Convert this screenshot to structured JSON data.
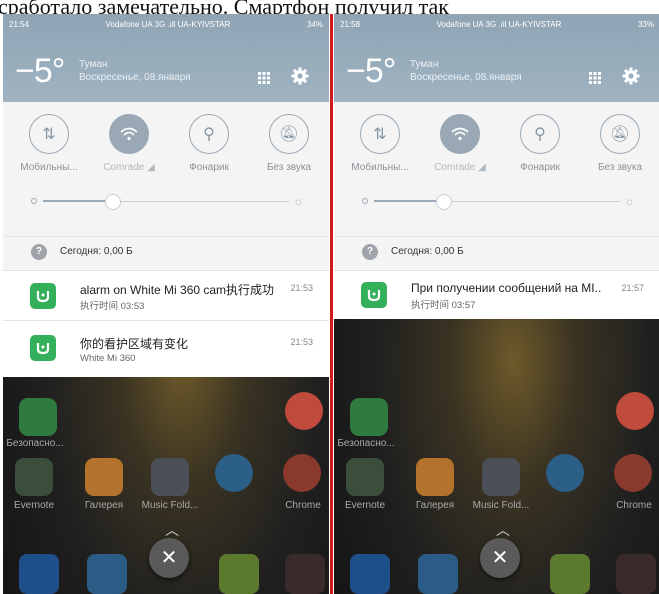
{
  "caption": "сработало замечательно. Смартфон получил так",
  "left": {
    "status": {
      "time": "21:54",
      "carriers": "Vodafone UA 3G  .ıll UA-KYIVSTAR",
      "battery": "34%"
    },
    "weather": {
      "temp": "−5°",
      "condition": "Туман",
      "date": "Воскресенье, 08.января"
    },
    "toggles": [
      {
        "label": "Мобильны...",
        "icon": "mobile-data-icon",
        "on": false
      },
      {
        "label": "Comrade ◢",
        "icon": "wifi-icon",
        "on": true
      },
      {
        "label": "Фонарик",
        "icon": "flashlight-icon",
        "on": false
      },
      {
        "label": "Без звука",
        "icon": "silent-bell-icon",
        "on": false
      }
    ],
    "brightness_level": 0.28,
    "data_usage": "Сегодня: 0,00 Б",
    "notifications": [
      {
        "title": "alarm on White Mi 360 cam执行成功",
        "sub": "执行时间 03:53",
        "time": "21:53"
      },
      {
        "title": "你的看护区域有变化",
        "sub": "White Mi 360",
        "time": "21:53"
      }
    ],
    "apps": [
      "Безопасно...",
      "Evernote",
      "Галерея",
      "Music Fold...",
      "Chrome"
    ]
  },
  "right": {
    "status": {
      "time": "21:58",
      "carriers": "Vodafone UA 3G  .ıll UA-KYIVSTAR",
      "battery": "33%"
    },
    "weather": {
      "temp": "−5°",
      "condition": "Туман",
      "date": "Воскресенье, 08.января"
    },
    "toggles": [
      {
        "label": "Мобильны...",
        "icon": "mobile-data-icon",
        "on": false
      },
      {
        "label": "Comrade ◢",
        "icon": "wifi-icon",
        "on": true
      },
      {
        "label": "Фонарик",
        "icon": "flashlight-icon",
        "on": false
      },
      {
        "label": "Без звука",
        "icon": "silent-bell-icon",
        "on": false
      }
    ],
    "brightness_level": 0.28,
    "data_usage": "Сегодня: 0,00 Б",
    "notifications": [
      {
        "title": "При получении сообщений на MI..",
        "sub": "执行时间 03:57",
        "time": "21:57"
      }
    ],
    "apps": [
      "Безопасно...",
      "Evernote",
      "Галерея",
      "Music Fold...",
      "Chrome"
    ]
  },
  "colors": {
    "accent": "#9aa8b5",
    "mi_home_green": "#34b05a",
    "divider": "#d11a1a"
  }
}
